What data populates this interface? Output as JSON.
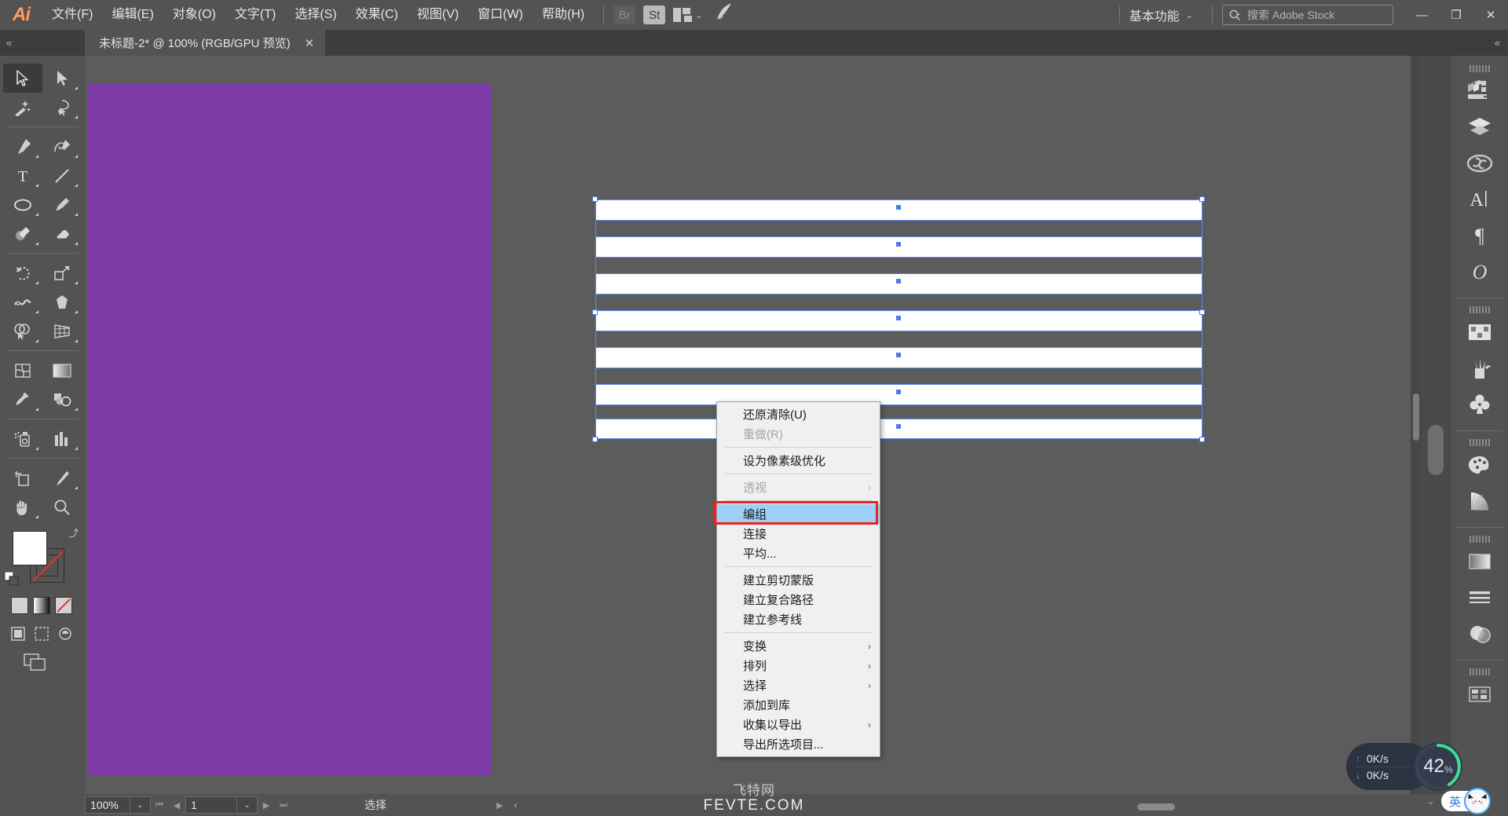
{
  "app": {
    "logo": "Ai",
    "menus": [
      {
        "label": "文件(F)",
        "name": "menu-file"
      },
      {
        "label": "编辑(E)",
        "name": "menu-edit"
      },
      {
        "label": "对象(O)",
        "name": "menu-object"
      },
      {
        "label": "文字(T)",
        "name": "menu-type"
      },
      {
        "label": "选择(S)",
        "name": "menu-select"
      },
      {
        "label": "效果(C)",
        "name": "menu-effect"
      },
      {
        "label": "视图(V)",
        "name": "menu-view"
      },
      {
        "label": "窗口(W)",
        "name": "menu-window"
      },
      {
        "label": "帮助(H)",
        "name": "menu-help"
      }
    ],
    "bridge_label": "Br",
    "stock_label": "St",
    "workspace": "基本功能",
    "search_placeholder": "搜索 Adobe Stock",
    "window_minimize": "—",
    "window_restore": "❐",
    "window_close": "✕"
  },
  "tabbar": {
    "collapse_left": "«",
    "collapse_right": "«",
    "doc_title": "未标题-2* @ 100% (RGB/GPU 预览)",
    "close": "✕"
  },
  "toolbar": {
    "tools": [
      {
        "name": "selection-tool",
        "label": "选择工具"
      },
      {
        "name": "direct-selection-tool",
        "label": "直接选择工具"
      },
      {
        "name": "magic-wand-tool",
        "label": "魔棒工具"
      },
      {
        "name": "lasso-tool",
        "label": "套索工具"
      },
      {
        "name": "pen-tool",
        "label": "钢笔工具"
      },
      {
        "name": "curvature-tool",
        "label": "曲率工具"
      },
      {
        "name": "type-tool",
        "label": "文字工具"
      },
      {
        "name": "line-segment-tool",
        "label": "直线段工具"
      },
      {
        "name": "ellipse-tool",
        "label": "椭圆工具"
      },
      {
        "name": "paintbrush-tool",
        "label": "画笔工具"
      },
      {
        "name": "shaper-tool",
        "label": "Shaper 工具"
      },
      {
        "name": "eraser-tool",
        "label": "橡皮擦工具"
      },
      {
        "name": "rotate-tool",
        "label": "旋转工具"
      },
      {
        "name": "scale-tool",
        "label": "比例缩放工具"
      },
      {
        "name": "width-tool",
        "label": "宽度工具"
      },
      {
        "name": "free-transform-tool",
        "label": "自由变换工具"
      },
      {
        "name": "shape-builder-tool",
        "label": "形状生成器工具"
      },
      {
        "name": "perspective-grid-tool",
        "label": "透视网格工具"
      },
      {
        "name": "mesh-tool",
        "label": "网格工具"
      },
      {
        "name": "gradient-tool",
        "label": "渐变工具"
      },
      {
        "name": "eyedropper-tool",
        "label": "吸管工具"
      },
      {
        "name": "blend-tool",
        "label": "混合工具"
      },
      {
        "name": "symbol-sprayer-tool",
        "label": "符号喷枪工具"
      },
      {
        "name": "column-graph-tool",
        "label": "柱形图工具"
      },
      {
        "name": "artboard-tool",
        "label": "画板工具"
      },
      {
        "name": "slice-tool",
        "label": "切片工具"
      },
      {
        "name": "hand-tool",
        "label": "抓手工具"
      },
      {
        "name": "zoom-tool",
        "label": "缩放工具"
      }
    ],
    "fill_color": "#ffffff",
    "stroke_color": "none",
    "modes": [
      "color-mode",
      "gradient-mode",
      "none-mode"
    ],
    "screen_modes": [
      "normal-screen-mode",
      "full-screen-menu-mode",
      "full-screen-mode"
    ]
  },
  "context_menu": {
    "groups": [
      {
        "items": [
          {
            "label": "还原清除(U)",
            "name": "ctx-undo",
            "disabled": false,
            "submenu": false,
            "selected": false
          },
          {
            "label": "重做(R)",
            "name": "ctx-redo",
            "disabled": true,
            "submenu": false,
            "selected": false
          }
        ]
      },
      {
        "items": [
          {
            "label": "设为像素级优化",
            "name": "ctx-make-pixel-perfect",
            "disabled": false,
            "submenu": false,
            "selected": false
          }
        ]
      },
      {
        "items": [
          {
            "label": "透视",
            "name": "ctx-perspective",
            "disabled": true,
            "submenu": true,
            "selected": false
          }
        ]
      },
      {
        "items": [
          {
            "label": "编组",
            "name": "ctx-group",
            "disabled": false,
            "submenu": false,
            "selected": true
          },
          {
            "label": "连接",
            "name": "ctx-join",
            "disabled": false,
            "submenu": false,
            "selected": false
          },
          {
            "label": "平均...",
            "name": "ctx-average",
            "disabled": false,
            "submenu": false,
            "selected": false
          }
        ]
      },
      {
        "items": [
          {
            "label": "建立剪切蒙版",
            "name": "ctx-make-clipping-mask",
            "disabled": false,
            "submenu": false,
            "selected": false
          },
          {
            "label": "建立复合路径",
            "name": "ctx-make-compound-path",
            "disabled": false,
            "submenu": false,
            "selected": false
          },
          {
            "label": "建立参考线",
            "name": "ctx-make-guides",
            "disabled": false,
            "submenu": false,
            "selected": false
          }
        ]
      },
      {
        "items": [
          {
            "label": "变换",
            "name": "ctx-transform",
            "disabled": false,
            "submenu": true,
            "selected": false
          },
          {
            "label": "排列",
            "name": "ctx-arrange",
            "disabled": false,
            "submenu": true,
            "selected": false
          },
          {
            "label": "选择",
            "name": "ctx-select",
            "disabled": false,
            "submenu": true,
            "selected": false
          },
          {
            "label": "添加到库",
            "name": "ctx-add-to-library",
            "disabled": false,
            "submenu": false,
            "selected": false
          },
          {
            "label": "收集以导出",
            "name": "ctx-collect-for-export",
            "disabled": false,
            "submenu": true,
            "selected": false
          },
          {
            "label": "导出所选项目...",
            "name": "ctx-export-selection",
            "disabled": false,
            "submenu": false,
            "selected": false
          }
        ]
      }
    ],
    "submenu_arrow": "›",
    "highlight_color": "#9ed0f5",
    "annotation_color": "#ef2020"
  },
  "canvas": {
    "artboard_color": "#7d3ba8",
    "background_color": "#5c5c5c",
    "stripe_color": "#ffffff",
    "selection_color": "#5a8cf0",
    "stripe_count": 7
  },
  "right_panel": {
    "groups": [
      {
        "icons": [
          {
            "name": "properties-icon",
            "label": "属性"
          },
          {
            "name": "layers-icon",
            "label": "图层"
          },
          {
            "name": "libraries-icon",
            "label": "库"
          },
          {
            "name": "character-icon",
            "label": "字符"
          },
          {
            "name": "paragraph-icon",
            "label": "段落"
          },
          {
            "name": "glyphs-icon",
            "label": "字形"
          }
        ]
      },
      {
        "icons": [
          {
            "name": "swatches-icon",
            "label": "色板"
          },
          {
            "name": "brushes-icon",
            "label": "画笔"
          },
          {
            "name": "symbols-icon",
            "label": "符号"
          }
        ]
      },
      {
        "icons": [
          {
            "name": "color-icon",
            "label": "颜色"
          },
          {
            "name": "color-guide-icon",
            "label": "颜色参考"
          }
        ]
      },
      {
        "icons": [
          {
            "name": "gradient-icon",
            "label": "渐变"
          },
          {
            "name": "stroke-icon",
            "label": "描边"
          },
          {
            "name": "transparency-icon",
            "label": "透明度"
          }
        ]
      },
      {
        "icons": [
          {
            "name": "appearance-icon",
            "label": "外观"
          }
        ]
      }
    ]
  },
  "statusbar": {
    "zoom_value": "100%",
    "zoom_dropdown": "⌄",
    "first_page": "⏮",
    "prev_page": "◀",
    "page_value": "1",
    "page_dropdown": "⌄",
    "next_page": "▶",
    "last_page": "⏭",
    "current_tool": "选择",
    "play_icon": "▶",
    "left_icon": "‹"
  },
  "watermark": {
    "cn": "飞特网",
    "en": "FEVTE.COM"
  },
  "net_widget": {
    "upload": "0K/s",
    "download": "0K/s",
    "percent": "42",
    "percent_unit": "%",
    "up_arrow": "↑",
    "down_arrow": "↓"
  },
  "ime": {
    "mode": "英",
    "chevron": "⌄"
  }
}
